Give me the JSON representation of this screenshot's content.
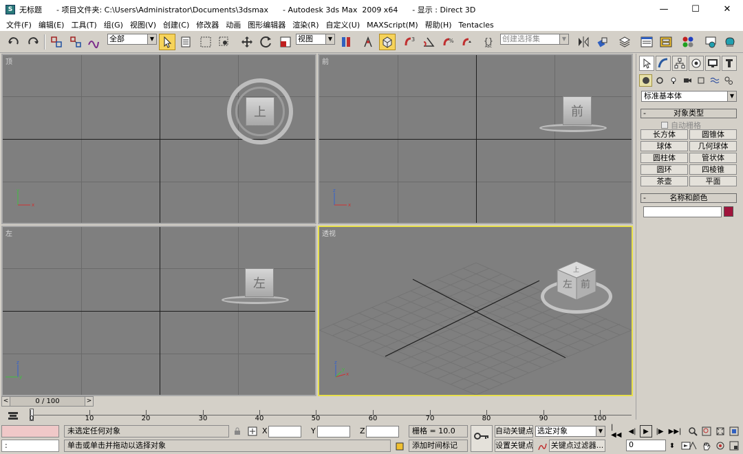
{
  "window": {
    "title_icon": "3ds-max-app-icon",
    "title": "无标题      - 项目文件夹: C:\\Users\\Administrator\\Documents\\3dsmax      - Autodesk 3ds Max  2009 x64      - 显示 : Direct 3D",
    "controls": {
      "minimize": "—",
      "maximize": "☐",
      "close": "✕"
    }
  },
  "menu": [
    "文件(F)",
    "编辑(E)",
    "工具(T)",
    "组(G)",
    "视图(V)",
    "创建(C)",
    "修改器",
    "动画",
    "图形编辑器",
    "渲染(R)",
    "自定义(U)",
    "MAXScript(M)",
    "帮助(H)",
    "Tentacles"
  ],
  "toolbar": {
    "selection_filter": "全部",
    "reference_coord": "视图",
    "named_selection_placeholder": "创建选择集"
  },
  "viewports": {
    "top": {
      "label": "顶",
      "cube_face": "上"
    },
    "front": {
      "label": "前",
      "cube_face": "前"
    },
    "left": {
      "label": "左",
      "cube_face": "左"
    },
    "perspective": {
      "label": "透视",
      "cube_left": "左",
      "cube_front": "前",
      "cube_top": "上"
    },
    "axes": {
      "x": "x",
      "y": "y",
      "z": "z"
    }
  },
  "command_panel": {
    "category": "标准基本体",
    "object_type_title": "对象类型",
    "autogrid_label": "自动栅格",
    "object_buttons": [
      "长方体",
      "圆锥体",
      "球体",
      "几何球体",
      "圆柱体",
      "管状体",
      "圆环",
      "四棱锥",
      "茶壶",
      "平面"
    ],
    "name_color_title": "名称和颜色",
    "object_color": "#a0143c"
  },
  "timeline": {
    "slider_text": "0 / 100",
    "ticks": [
      "0",
      "10",
      "20",
      "30",
      "40",
      "50",
      "60",
      "70",
      "80",
      "90",
      "100"
    ],
    "current_frame": 0
  },
  "status": {
    "selection_info": "未选定任何对象",
    "prompt": "单击或单击并拖动以选择对象",
    "maxscript_listener": ":",
    "x_label": "X",
    "y_label": "Y",
    "z_label": "Z",
    "grid_label": "栅格 = 10.0",
    "add_time_tag": "添加时间标记",
    "auto_key": "自动关键点",
    "set_key": "设置关键点",
    "key_mode": "选定对象",
    "key_filters": "关键点过滤器...",
    "frame_value": "0"
  }
}
